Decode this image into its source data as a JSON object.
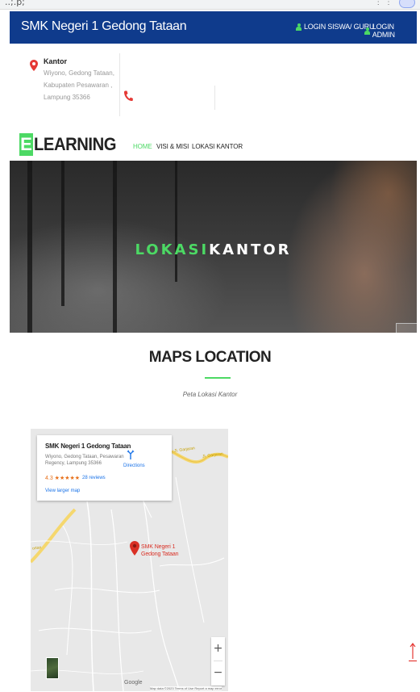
{
  "browser": {
    "url_fragment": "..;.p;",
    "menu_dots": "⋮ ⋮"
  },
  "header": {
    "site_title": "SMK Negeri 1 Gedong Tataan",
    "login_siswa": "LOGIN SISWA/ GURU",
    "login_admin": "LOGIN ADMIN"
  },
  "contact": {
    "office_title": "Kantor",
    "address_lines": [
      "Wiyono, Gedong Tataan,",
      "Kabupaten Pesawaran ,",
      "Lampung 35366"
    ]
  },
  "nav": {
    "brand_first": "E",
    "brand_rest": "LEARNING",
    "items": [
      {
        "label": "HOME",
        "active": true
      },
      {
        "label": "VISI & MISI",
        "active": false
      },
      {
        "label": "LOKASI KANTOR",
        "active": false
      }
    ]
  },
  "hero": {
    "title_part1": "LOKASI",
    "title_part2": "KANTOR"
  },
  "maps_section": {
    "title": "MAPS LOCATION",
    "subtitle": "Peta Lokasi Kantor"
  },
  "map": {
    "place_name": "SMK Negeri 1 Gedong Tataan",
    "place_address_lines": [
      "Wiyono, Gedong Tataan, Pesawaran",
      "Regency, Lampung 35366"
    ],
    "rating": "4.3 ★★★★★",
    "reviews": "28 reviews",
    "directions": "Directions",
    "view_larger": "View larger map",
    "marker_label_lines": [
      "SMK Negeri 1",
      "Gedong Tataan"
    ],
    "road_labels": [
      "Jl. Garjaran",
      "Jl. Garjaran",
      "ortan"
    ],
    "zoom_in": "+",
    "zoom_out": "−",
    "google": "Google",
    "footer": "Map data ©2023   Terms of Use   Report a map error"
  },
  "colors": {
    "topbar": "#0f3b8c",
    "accent": "#4cd964",
    "marker": "#d93025",
    "scroll_arrow": "#e53935"
  }
}
